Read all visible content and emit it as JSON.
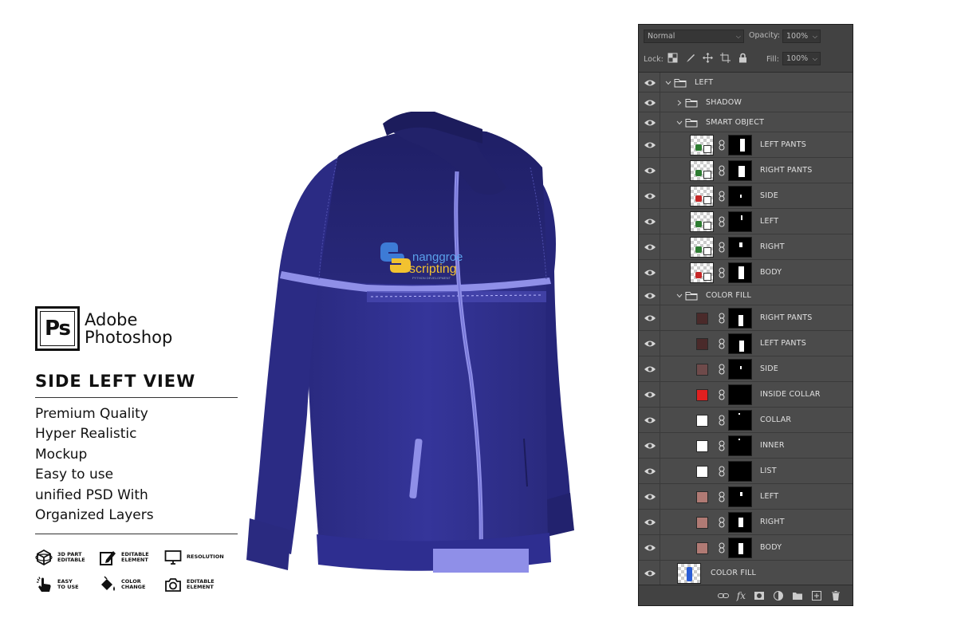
{
  "brand": {
    "logo_text": "Ps",
    "name_line1": "Adobe",
    "name_line2": "Photoshop"
  },
  "view_title": "SIDE LEFT VIEW",
  "features": [
    "Premium Quality",
    "Hyper Realistic",
    "Mockup",
    "Easy to use",
    "unified PSD With",
    "Organized Layers"
  ],
  "badges": [
    {
      "icon": "3d-cube-icon",
      "label": "3D PART\nEDITABLE"
    },
    {
      "icon": "edit-pencil-icon",
      "label": "EDITABLE\nELEMENT"
    },
    {
      "icon": "monitor-icon",
      "label": "RESOLUTION"
    },
    {
      "icon": "hand-tap-icon",
      "label": "EASY\nTO USE"
    },
    {
      "icon": "paint-bucket-icon",
      "label": "COLOR\nCHANGE"
    },
    {
      "icon": "camera-icon",
      "label": "EDITABLE\nELEMENT"
    }
  ],
  "jacket": {
    "logo_line1": "nanggroe",
    "logo_line2": "scripting",
    "logo_tagline": "PYTHON DEVELOPMENT",
    "colors": {
      "body": "#2f2f8a",
      "dark": "#22226a",
      "accent": "#8f8fe8"
    }
  },
  "panel": {
    "blend_mode": "Normal",
    "opacity_label": "Opacity:",
    "opacity_value": "100%",
    "lock_label": "Lock:",
    "fill_label": "Fill:",
    "fill_value": "100%",
    "layers": [
      {
        "name": "LEFT",
        "kind": "group-open",
        "level": 0
      },
      {
        "name": "SHADOW",
        "kind": "group-closed",
        "level": 1
      },
      {
        "name": "SMART OBJECT",
        "kind": "group-open",
        "level": 1
      },
      {
        "name": "LEFT PANTS",
        "kind": "smart",
        "level": 2,
        "blob": "#2e7d32"
      },
      {
        "name": "RIGHT PANTS",
        "kind": "smart",
        "level": 2,
        "blob": "#2e7d32"
      },
      {
        "name": "SIDE",
        "kind": "smart",
        "level": 2,
        "blob": "#c62828"
      },
      {
        "name": "LEFT",
        "kind": "smart",
        "level": 2,
        "blob": "#2e7d32"
      },
      {
        "name": "RIGHT",
        "kind": "smart",
        "level": 2,
        "blob": "#2e7d32"
      },
      {
        "name": "BODY",
        "kind": "smart",
        "level": 2,
        "blob": "#c62828"
      },
      {
        "name": "COLOR FILL",
        "kind": "group-open",
        "level": 1
      },
      {
        "name": "RIGHT PANTS",
        "kind": "fill",
        "level": 2,
        "color": "#4a2a2a"
      },
      {
        "name": "LEFT PANTS",
        "kind": "fill",
        "level": 2,
        "color": "#4a2a2a"
      },
      {
        "name": "SIDE",
        "kind": "fill",
        "level": 2,
        "color": "#6e4a4a"
      },
      {
        "name": "INSIDE COLLAR",
        "kind": "fill",
        "level": 2,
        "color": "#e02020"
      },
      {
        "name": "COLLAR",
        "kind": "fill",
        "level": 2,
        "color": "#ffffff"
      },
      {
        "name": "INNER",
        "kind": "fill",
        "level": 2,
        "color": "#ffffff"
      },
      {
        "name": "LIST",
        "kind": "fill",
        "level": 2,
        "color": "#ffffff"
      },
      {
        "name": "LEFT",
        "kind": "fill",
        "level": 2,
        "color": "#b07a74"
      },
      {
        "name": "RIGHT",
        "kind": "fill",
        "level": 2,
        "color": "#b07a74"
      },
      {
        "name": "BODY",
        "kind": "fill",
        "level": 2,
        "color": "#b07a74"
      },
      {
        "name": "COLOR FILL",
        "kind": "root-smart",
        "level": 0
      }
    ],
    "bottom_icons": [
      "link-layers-icon",
      "fx-icon",
      "mask-icon",
      "adjustment-icon",
      "new-group-icon",
      "new-layer-icon",
      "trash-icon"
    ]
  }
}
